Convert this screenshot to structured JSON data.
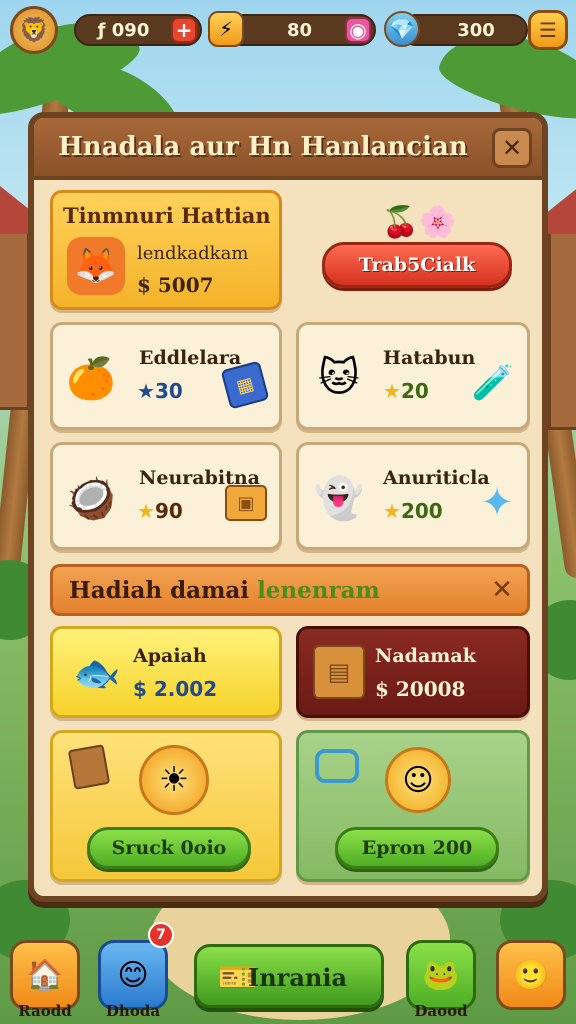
{
  "resources": [
    {
      "name": "coins",
      "value": "090",
      "prefix": "ƒ",
      "icon": "coin-icon",
      "color": "#f4b32a"
    },
    {
      "name": "energy",
      "value": "80",
      "icon": "lightning-icon",
      "color": "#f0a81c"
    },
    {
      "name": "gems",
      "value": "300",
      "icon": "gem-icon",
      "color": "#5bb6e0"
    }
  ],
  "panel": {
    "title": "Hnadala aur Hn Hanlancian"
  },
  "featured": {
    "name": "Tinmnuri Hattian",
    "subtitle": "lendkadkam",
    "price": "$ 5007",
    "button_label": "Trab5Cialk"
  },
  "items": [
    {
      "name": "Eddlelara",
      "price": "30",
      "character_icon": "orange-chef-icon",
      "extra_icon": "blue-box-icon"
    },
    {
      "name": "Hatabun",
      "price": "20",
      "character_icon": "green-cat-icon",
      "extra_icon": "potion-icon"
    },
    {
      "name": "Neurabitna",
      "price": "90",
      "character_icon": "coconut-icon",
      "extra_icon": "treasure-chest-icon"
    },
    {
      "name": "Anuriticla",
      "price": "200",
      "character_icon": "blue-ghost-icon",
      "extra_icon": "crystal-star-icon"
    }
  ],
  "banner": {
    "text": "Hadiah damai",
    "highlight": "lenenram"
  },
  "offers": [
    {
      "name": "Apaiah",
      "price": "$ 2.002",
      "icon": "blue-fish-icon"
    },
    {
      "name": "Nadamak",
      "price": "$ 20008",
      "icon": "crate-icon"
    }
  ],
  "bundles": [
    {
      "button_label": "Sruck 0oio",
      "icon": "sun-coin-icon"
    },
    {
      "button_label": "Epron 200",
      "icon": "sun-smile-icon"
    }
  ],
  "bottom_nav": {
    "left1": "Raodd",
    "left2": "Dhoda",
    "left2_badge": "7",
    "center": "Inrania",
    "right1": "Daood"
  },
  "colors": {
    "panel_border": "#6e4322",
    "accent_green": "#4fae25",
    "accent_red": "#d4321f",
    "gold": "#f4b32a"
  }
}
